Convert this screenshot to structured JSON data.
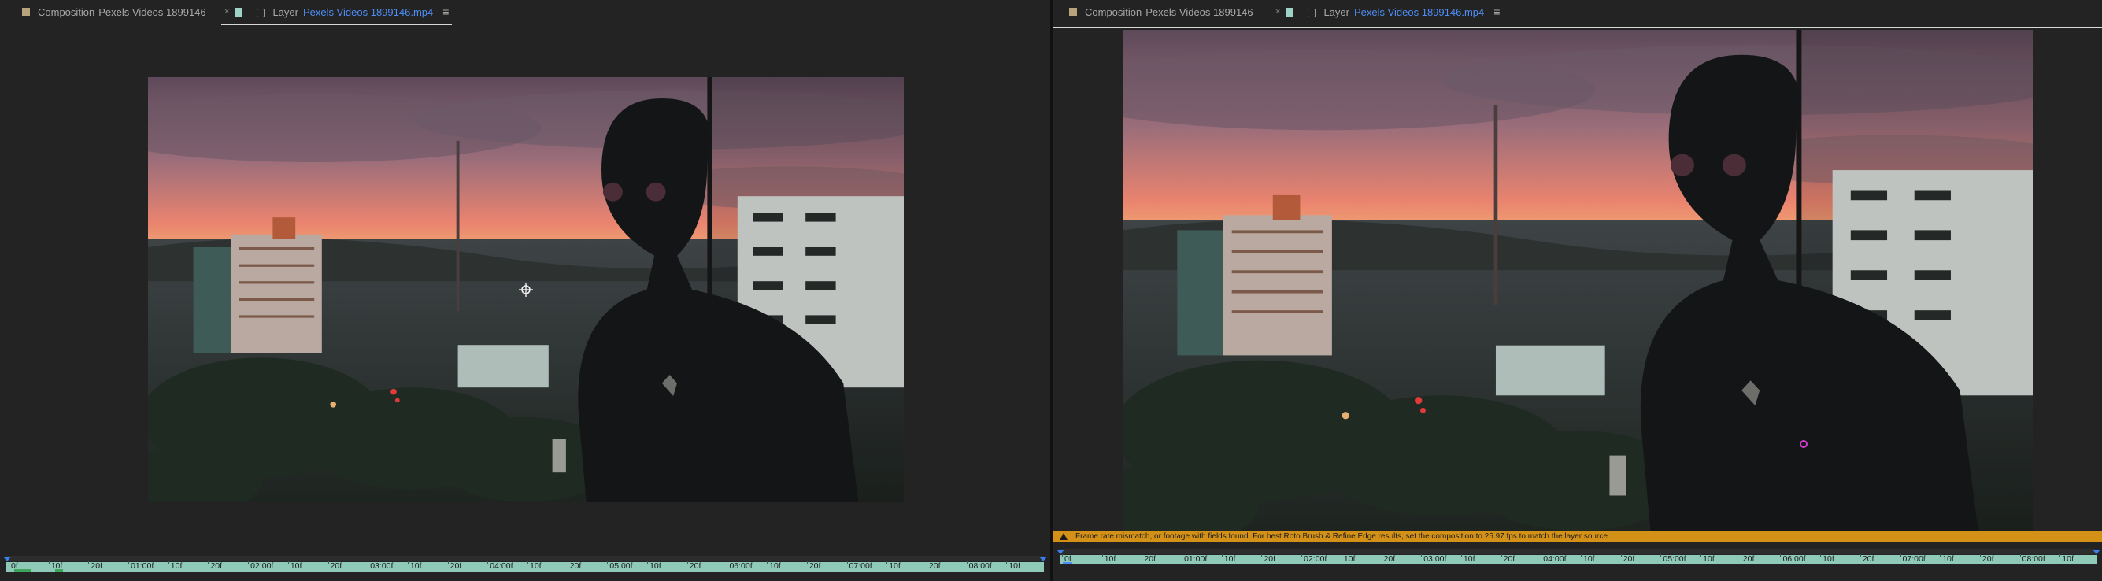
{
  "left_panel": {
    "tabs": {
      "composition": {
        "kind": "Composition",
        "name": "Pexels Videos 1899146"
      },
      "layer": {
        "kind": "Layer",
        "file": "Pexels Videos 1899146.mp4"
      }
    },
    "timeline_labels": [
      "0f",
      "10f",
      "20f",
      "01:00f",
      "10f",
      "20f",
      "02:00f",
      "10f",
      "20f",
      "03:00f",
      "10f",
      "20f",
      "04:00f",
      "10f",
      "20f",
      "05:00f",
      "10f",
      "20f",
      "06:00f",
      "10f",
      "20f",
      "07:00f",
      "10f",
      "20f",
      "08:00f",
      "10f"
    ]
  },
  "right_panel": {
    "tabs": {
      "composition": {
        "kind": "Composition",
        "name": "Pexels Videos 1899146"
      },
      "layer": {
        "kind": "Layer",
        "file": "Pexels Videos 1899146.mp4"
      }
    },
    "warning": "Frame rate mismatch, or footage with fields found. For best Roto Brush & Refine Edge results, set the composition to 25.97 fps to match the layer source.",
    "timeline_labels": [
      "0f",
      "10f",
      "20f",
      "01:00f",
      "10f",
      "20f",
      "02:00f",
      "10f",
      "20f",
      "03:00f",
      "10f",
      "20f",
      "04:00f",
      "10f",
      "20f",
      "05:00f",
      "10f",
      "20f",
      "06:00f",
      "10f",
      "20f",
      "07:00f",
      "10f",
      "20f",
      "08:00f",
      "10f"
    ]
  },
  "icons": {
    "menu": "≡",
    "close": "×"
  },
  "colors": {
    "accent_blue": "#4d8df5",
    "warning": "#d39118",
    "timeline_bar": "#8fc9b7",
    "roto_brush": "#d13cd1",
    "composition_swatch": "#b8a37c",
    "layer_swatch": "#9fd3c7"
  }
}
